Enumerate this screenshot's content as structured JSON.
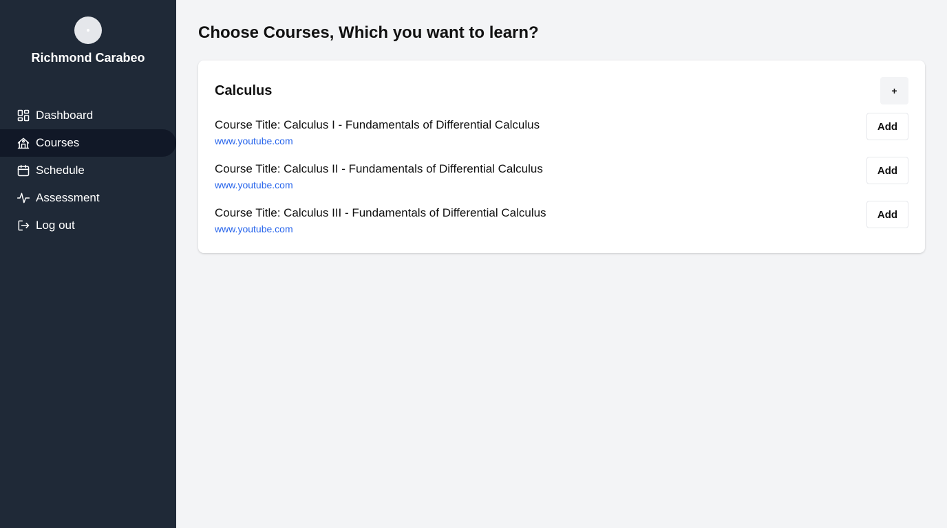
{
  "sidebar": {
    "username": "Richmond Carabeo",
    "items": [
      {
        "label": "Dashboard",
        "icon": "dashboard-icon"
      },
      {
        "label": "Courses",
        "icon": "courses-icon",
        "active": true
      },
      {
        "label": "Schedule",
        "icon": "calendar-icon"
      },
      {
        "label": "Assessment",
        "icon": "activity-icon"
      },
      {
        "label": "Log out",
        "icon": "logout-icon"
      }
    ]
  },
  "main": {
    "title": "Choose Courses, Which you want to learn?",
    "card": {
      "title": "Calculus",
      "plus_label": "+",
      "courses": [
        {
          "title": "Course Title: Calculus I - Fundamentals of Differential Calculus",
          "link": "www.youtube.com",
          "button": "Add"
        },
        {
          "title": "Course Title: Calculus II - Fundamentals of Differential Calculus",
          "link": "www.youtube.com",
          "button": "Add"
        },
        {
          "title": "Course Title: Calculus III - Fundamentals of Differential Calculus",
          "link": "www.youtube.com",
          "button": "Add"
        }
      ]
    }
  },
  "colors": {
    "sidebar_bg": "#1f2937",
    "active_item_bg": "#111827",
    "page_bg": "#f3f4f6",
    "link": "#2563eb"
  }
}
